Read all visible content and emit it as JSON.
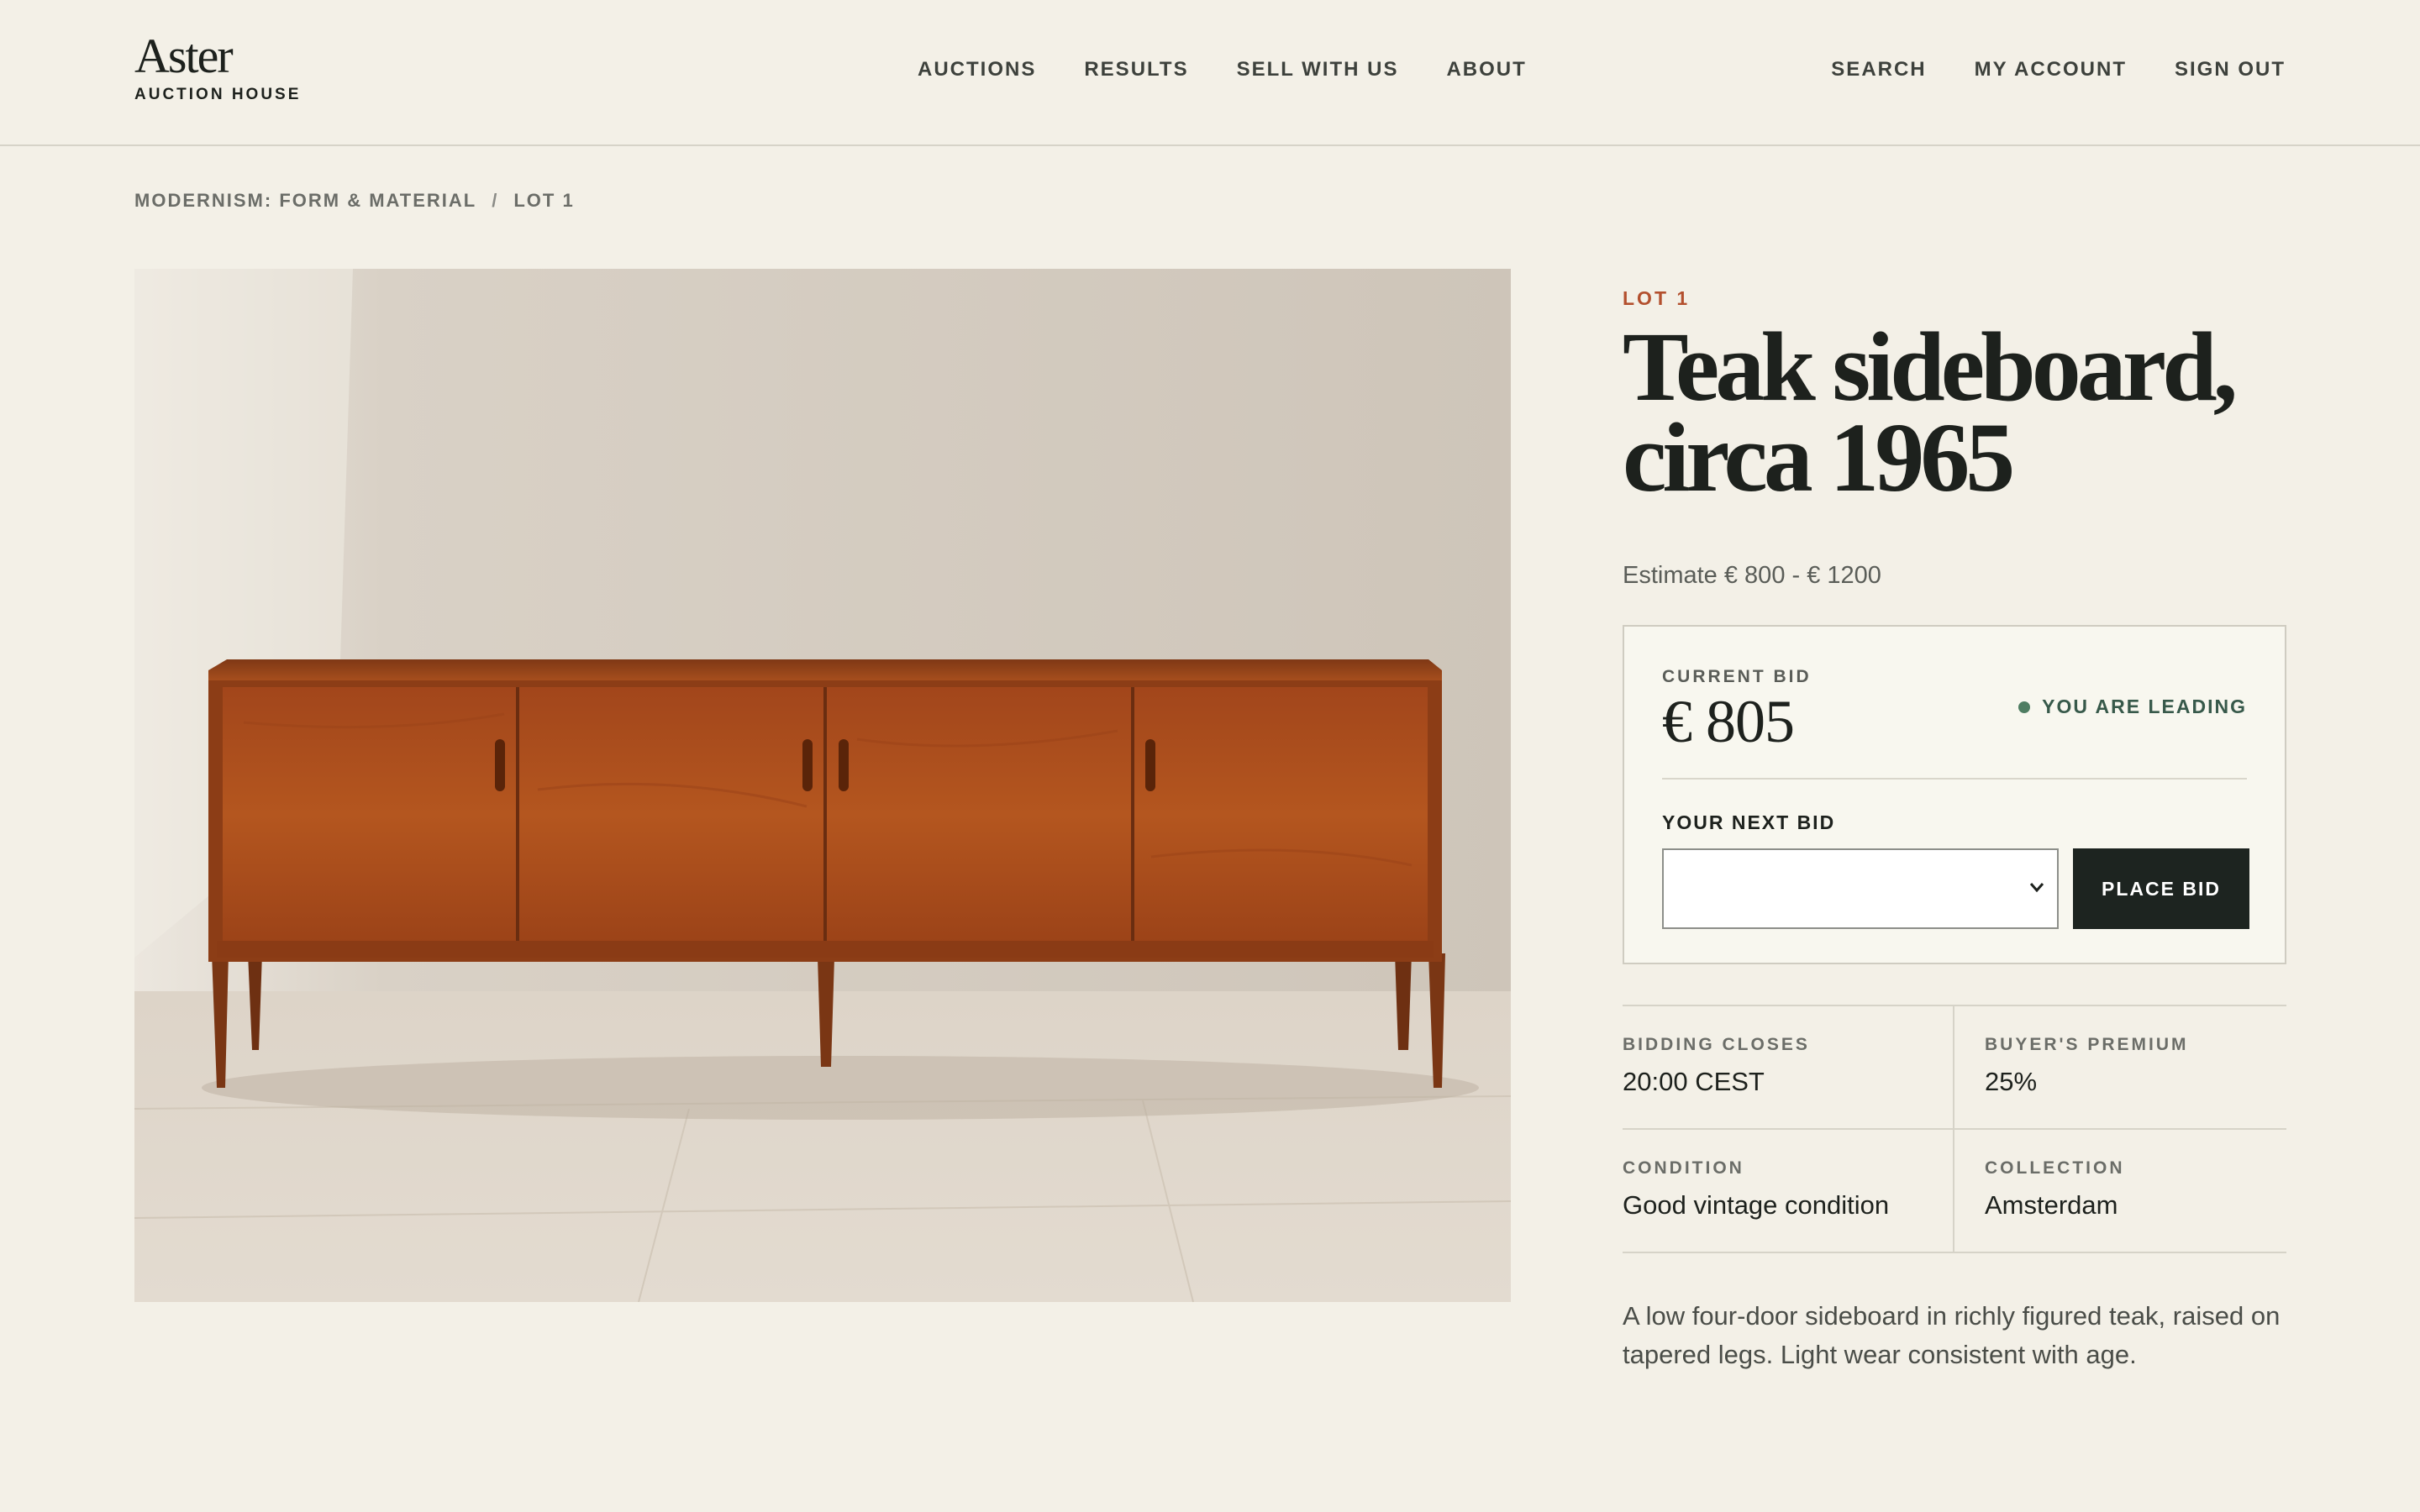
{
  "brand": {
    "name": "Aster",
    "subtitle": "AUCTION HOUSE"
  },
  "nav": {
    "main": [
      "AUCTIONS",
      "RESULTS",
      "SELL WITH US",
      "ABOUT"
    ],
    "account": [
      "SEARCH",
      "MY ACCOUNT",
      "SIGN OUT"
    ]
  },
  "breadcrumb": {
    "collection": "MODERNISM: FORM & MATERIAL",
    "separator": "/",
    "lot": "LOT 1"
  },
  "lot": {
    "label": "LOT 1",
    "title_line1": "Teak sideboard,",
    "title_line2": "circa 1965",
    "estimate": "Estimate € 800 - € 1200",
    "image_subject": "teak four-door sideboard"
  },
  "bidding": {
    "current_bid_label": "CURRENT BID",
    "current_bid": "€ 805",
    "status": "YOU ARE LEADING",
    "next_bid_label": "YOUR NEXT BID",
    "next_bid_value": "",
    "place_bid_label": "PLACE BID"
  },
  "details": [
    {
      "label": "BIDDING CLOSES",
      "value": "20:00 CEST"
    },
    {
      "label": "BUYER'S PREMIUM",
      "value": "25%"
    },
    {
      "label": "CONDITION",
      "value": "Good vintage condition"
    },
    {
      "label": "COLLECTION",
      "value": "Amsterdam"
    }
  ],
  "description": "A low four-door sideboard in richly figured teak, raised on tapered legs. Light wear consistent with age.",
  "colors": {
    "background": "#f3f0e7",
    "accent_lot": "#b3502e",
    "leading_dot": "#4f7d62",
    "button": "#1d2420"
  }
}
